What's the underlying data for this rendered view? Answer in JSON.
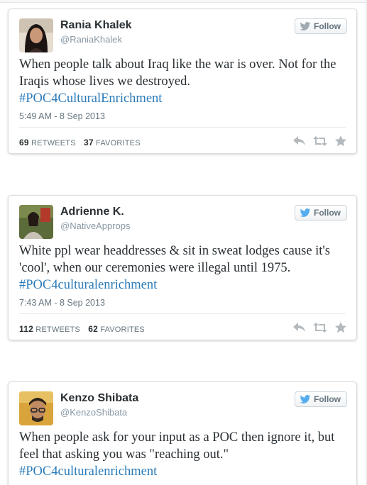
{
  "follow_label": "Follow",
  "retweets_label": "RETWEETS",
  "favorites_label": "FAVORITES",
  "colors": {
    "link": "#2b7bb9",
    "text": "#292f33",
    "muted": "#8899a6",
    "twitter_blue": "#55acee"
  },
  "tweets": [
    {
      "name": "Rania Khalek",
      "handle": "@RaniaKhalek",
      "text": "When people talk about Iraq like the war is over. Not for the Iraqis whose lives we destroyed.",
      "hashtag": "#POC4CulturalEnrichment",
      "timestamp": "5:49 AM - 8 Sep 2013",
      "retweets": "69",
      "favorites": "37",
      "follow_bird_color": "gray"
    },
    {
      "name": "Adrienne K.",
      "handle": "@NativeApprops",
      "text": "White ppl wear headdresses & sit in sweat lodges cause it's 'cool', when our ceremonies were illegal until 1975.",
      "hashtag": "#POC4culturalenrichment",
      "timestamp": "7:43 AM - 8 Sep 2013",
      "retweets": "112",
      "favorites": "62",
      "follow_bird_color": "blue"
    },
    {
      "name": "Kenzo Shibata",
      "handle": "@KenzoShibata",
      "text": "When people ask for your input as a POC then ignore it, but feel that asking you was \"reaching out.\"",
      "hashtag": "#POC4culturalenrichment",
      "follow_bird_color": "blue"
    }
  ]
}
